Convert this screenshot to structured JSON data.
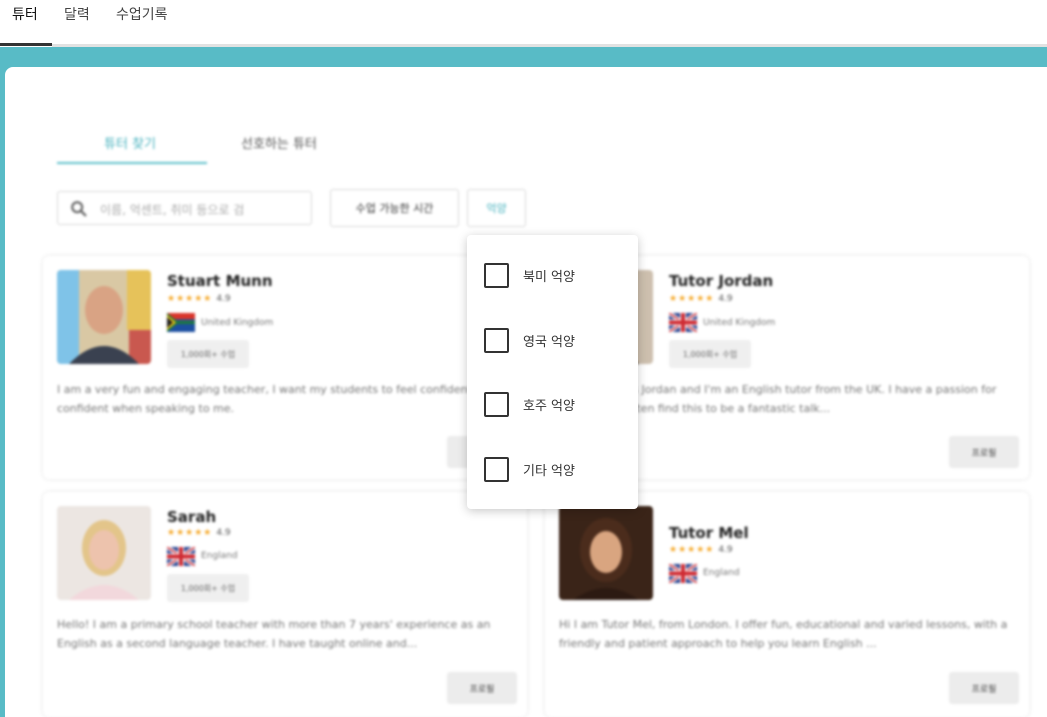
{
  "topnav": {
    "items": [
      {
        "label": "튜터",
        "active": true
      },
      {
        "label": "달력",
        "active": false
      },
      {
        "label": "수업기록",
        "active": false
      }
    ]
  },
  "subtabs": [
    {
      "label": "튜터 찾기",
      "active": true
    },
    {
      "label": "선호하는 튜터",
      "active": false
    }
  ],
  "search": {
    "placeholder": "이름, 억센트, 취미 등으로 검"
  },
  "filters": {
    "time_label": "수업 가능한 시간",
    "accent_label": "억양"
  },
  "accent_dropdown": {
    "options": [
      {
        "label": "북미 억양",
        "checked": false
      },
      {
        "label": "영국 억양",
        "checked": false
      },
      {
        "label": "호주 억양",
        "checked": false
      },
      {
        "label": "기타 억양",
        "checked": false
      }
    ]
  },
  "tutors": [
    {
      "name": "Stuart Munn",
      "stars": "★★★★★",
      "rating": "4.9",
      "country": "United Kingdom",
      "flag": "south-africa",
      "lessons": "1,000회+ 수업",
      "bio": "I am a very fun and engaging teacher, I want my students to feel confident and confident when speaking to me.",
      "profile_label": "프로필"
    },
    {
      "name": "Tutor Jordan",
      "stars": "★★★★★",
      "rating": "4.9",
      "country": "United Kingdom",
      "flag": "uk",
      "lessons": "1,000회+ 수업",
      "bio": "Hi, my name's Jordan and I'm an English tutor from the UK. I have a passion for music and I often find this to be a fantastic talk...",
      "profile_label": "프로필"
    },
    {
      "name": "Sarah",
      "stars": "★★★★★",
      "rating": "4.9",
      "country": "England",
      "flag": "uk",
      "lessons": "1,000회+ 수업",
      "bio": "Hello! I am a primary school teacher with more than 7 years' experience as an English as a second language teacher. I have taught online and...",
      "profile_label": "프로필"
    },
    {
      "name": "Tutor Mel",
      "stars": "★★★★★",
      "rating": "4.9",
      "country": "England",
      "flag": "uk",
      "lessons": "",
      "bio": "Hi I am Tutor Mel, from London. I offer fun, educational and varied lessons, with a friendly and patient approach to help you learn English ...",
      "profile_label": "프로필"
    }
  ],
  "colors": {
    "accent": "#58bbc6",
    "star": "#f5a623"
  }
}
